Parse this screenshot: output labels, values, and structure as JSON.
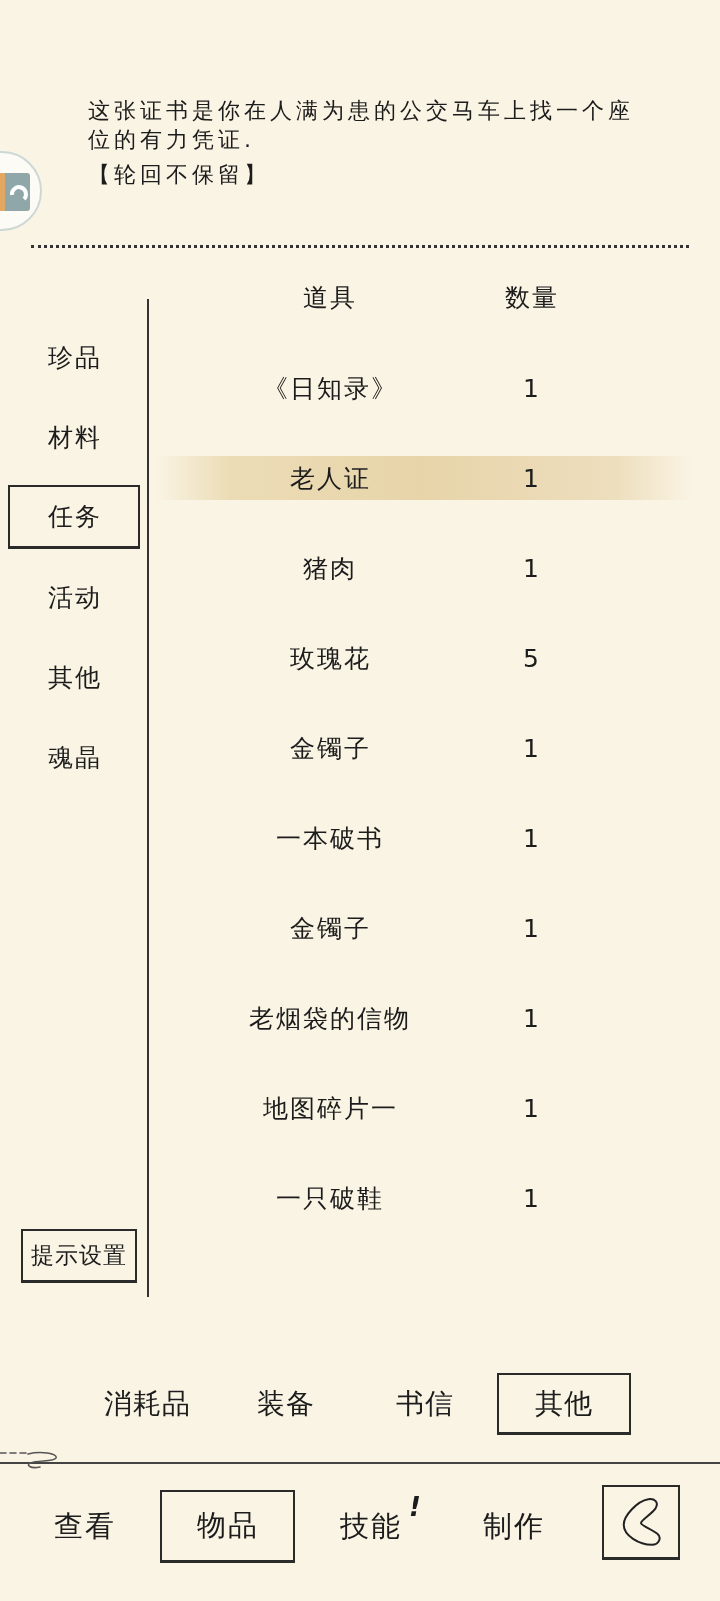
{
  "description": {
    "text": "这张证书是你在人满为患的公交马车上找一个座位的有力凭证.",
    "note": "【轮回不保留】"
  },
  "sidebar": {
    "items": [
      {
        "label": "珍品",
        "selected": false
      },
      {
        "label": "材料",
        "selected": false
      },
      {
        "label": "任务",
        "selected": true
      },
      {
        "label": "活动",
        "selected": false
      },
      {
        "label": "其他",
        "selected": false
      },
      {
        "label": "魂晶",
        "selected": false
      }
    ],
    "hint_button": "提示设置"
  },
  "table": {
    "columns": [
      "道具",
      "数量"
    ],
    "rows": [
      {
        "name": "《日知录》",
        "quantity": "1",
        "selected": false
      },
      {
        "name": "老人证",
        "quantity": "1",
        "selected": true
      },
      {
        "name": "猪肉",
        "quantity": "1",
        "selected": false
      },
      {
        "name": "玫瑰花",
        "quantity": "5",
        "selected": false
      },
      {
        "name": "金镯子",
        "quantity": "1",
        "selected": false
      },
      {
        "name": "一本破书",
        "quantity": "1",
        "selected": false
      },
      {
        "name": "金镯子",
        "quantity": "1",
        "selected": false
      },
      {
        "name": "老烟袋的信物",
        "quantity": "1",
        "selected": false
      },
      {
        "name": "地图碎片一",
        "quantity": "1",
        "selected": false
      },
      {
        "name": "一只破鞋",
        "quantity": "1",
        "selected": false
      }
    ]
  },
  "category_tabs": [
    {
      "label": "消耗品",
      "selected": false
    },
    {
      "label": "装备",
      "selected": false
    },
    {
      "label": "书信",
      "selected": false
    },
    {
      "label": "其他",
      "selected": true
    }
  ],
  "bottom_nav": {
    "items": [
      {
        "label": "查看",
        "selected": false
      },
      {
        "label": "物品",
        "selected": true
      },
      {
        "label": "技能",
        "selected": false,
        "badge": "!"
      },
      {
        "label": "制作",
        "selected": false
      }
    ]
  }
}
